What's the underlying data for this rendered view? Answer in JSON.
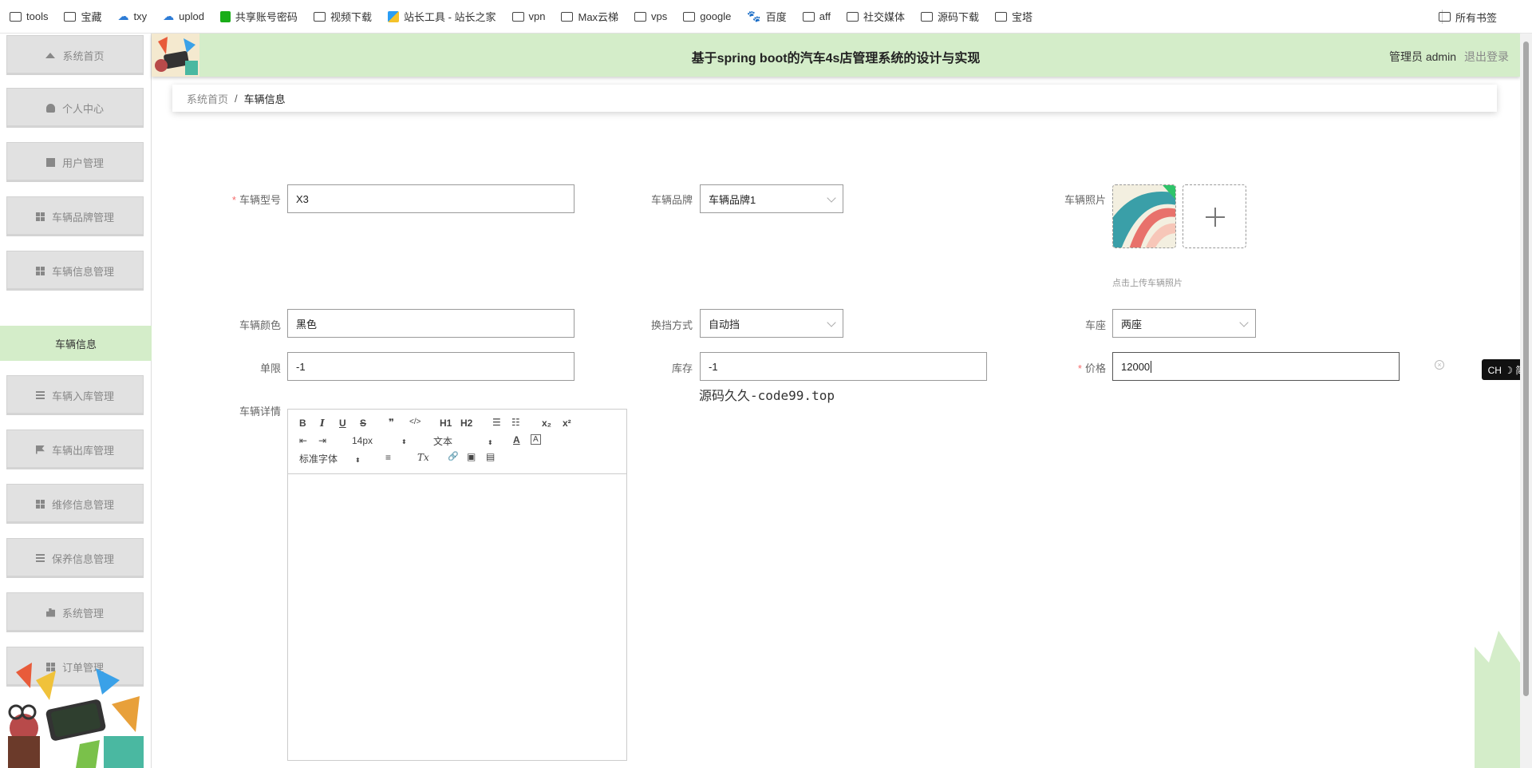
{
  "bookmarks": {
    "items": [
      {
        "label": "tools",
        "icon": "folder-icon"
      },
      {
        "label": "宝藏",
        "icon": "folder-icon"
      },
      {
        "label": "txy",
        "icon": "cloud-icon"
      },
      {
        "label": "uplod",
        "icon": "cloud-icon"
      },
      {
        "label": "共享账号密码",
        "icon": "sheet-icon"
      },
      {
        "label": "视频下载",
        "icon": "folder-icon"
      },
      {
        "label": "站长工具 - 站长之家",
        "icon": "tool-icon"
      },
      {
        "label": "vpn",
        "icon": "folder-icon"
      },
      {
        "label": "Max云梯",
        "icon": "folder-icon"
      },
      {
        "label": "vps",
        "icon": "folder-icon"
      },
      {
        "label": "google",
        "icon": "folder-icon"
      },
      {
        "label": "百度",
        "icon": "paw-icon"
      },
      {
        "label": "aff",
        "icon": "folder-icon"
      },
      {
        "label": "社交媒体",
        "icon": "folder-icon"
      },
      {
        "label": "源码下载",
        "icon": "folder-icon"
      },
      {
        "label": "宝塔",
        "icon": "folder-icon"
      }
    ],
    "all_bookmarks": "所有书签"
  },
  "header": {
    "title": "基于spring boot的汽车4s店管理系统的设计与实现",
    "user": "管理员 admin",
    "logout": "退出登录",
    "bg_color": "#d4edc9"
  },
  "sidebar": {
    "items": [
      {
        "label": "系统首页",
        "icon": "home-icon"
      },
      {
        "label": "个人中心",
        "icon": "user-icon"
      },
      {
        "label": "用户管理",
        "icon": "clipboard-icon"
      },
      {
        "label": "车辆品牌管理",
        "icon": "grid-icon"
      },
      {
        "label": "车辆信息管理",
        "icon": "grid-icon"
      },
      {
        "label": "车辆入库管理",
        "icon": "list-icon"
      },
      {
        "label": "车辆出库管理",
        "icon": "flag-icon"
      },
      {
        "label": "维修信息管理",
        "icon": "grid-icon"
      },
      {
        "label": "保养信息管理",
        "icon": "list-icon"
      },
      {
        "label": "系统管理",
        "icon": "chart-icon"
      },
      {
        "label": "订单管理",
        "icon": "grid-icon"
      }
    ],
    "active_sub": "车辆信息"
  },
  "breadcrumb": {
    "home": "系统首页",
    "separator": "/",
    "current": "车辆信息"
  },
  "form": {
    "model_label": "车辆型号",
    "model_value": "X3",
    "brand_label": "车辆品牌",
    "brand_value": "车辆品牌1",
    "photo_label": "车辆照片",
    "photo_hint": "点击上传车辆照片",
    "color_label": "车辆颜色",
    "color_value": "黑色",
    "gear_label": "换挡方式",
    "gear_value": "自动挡",
    "seat_label": "车座",
    "seat_value": "两座",
    "limit_label": "单限",
    "limit_value": "-1",
    "stock_label": "库存",
    "stock_value": "-1",
    "price_label": "价格",
    "price_value": "12000",
    "detail_label": "车辆详情"
  },
  "editor": {
    "toolbar": {
      "bold": "B",
      "italic": "I",
      "underline": "U",
      "strike": "S",
      "quote": "❞",
      "code": "</>",
      "h1": "H1",
      "h2": "H2",
      "ordered_list": "☰",
      "bullet_list": "☷",
      "sub": "x₂",
      "sup": "x²",
      "outdent": "⇤",
      "indent": "⇥",
      "size": "14px",
      "header_select": "文本",
      "color": "A",
      "bg_color": "A",
      "font": "标准字体",
      "align": "≡",
      "clean": "Tx",
      "link": "🔗",
      "image": "▣",
      "video": "▤"
    }
  },
  "watermark": "源码久久-code99.top",
  "ime": "CH ☽ 简"
}
